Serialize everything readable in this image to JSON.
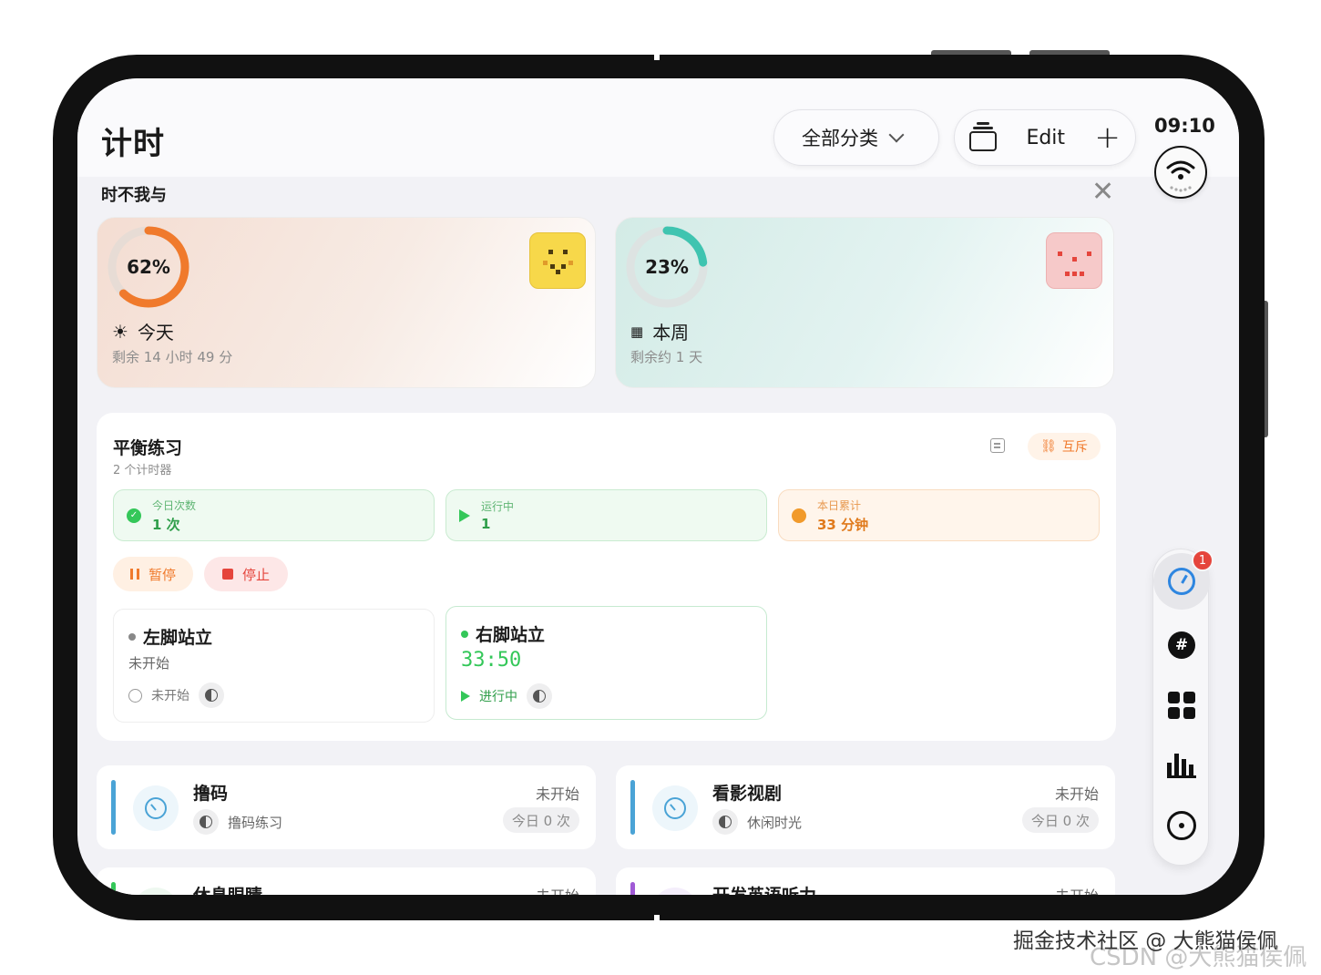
{
  "header": {
    "title": "计时",
    "category_filter": "全部分类",
    "edit_label": "Edit",
    "time": "09:10"
  },
  "section": {
    "title": "时不我与"
  },
  "progress": {
    "today": {
      "percent_label": "62%",
      "percent": 62,
      "label": "今天",
      "remaining": "剩余 14 小时 49 分",
      "color": "#f07a2c"
    },
    "week": {
      "percent_label": "23%",
      "percent": 23,
      "label": "本周",
      "remaining": "剩余约 1 天",
      "color": "#3fc4b0"
    }
  },
  "group": {
    "title": "平衡练习",
    "subtitle": "2 个计时器",
    "mutex_label": "互斥",
    "stats": [
      {
        "label": "今日次数",
        "value": "1 次"
      },
      {
        "label": "运行中",
        "value": "1"
      },
      {
        "label": "本日累计",
        "value": "33 分钟"
      }
    ],
    "pause_label": "暂停",
    "stop_label": "停止",
    "timers": [
      {
        "title": "左脚站立",
        "status": "未开始",
        "state": "未开始"
      },
      {
        "title": "右脚站立",
        "time": "33:50",
        "state": "进行中"
      }
    ]
  },
  "timers": [
    {
      "title": "撸码",
      "category": "撸码练习",
      "status": "未开始",
      "count": "今日 0 次",
      "accent": "#4aa3d6"
    },
    {
      "title": "看影视剧",
      "category": "休闲时光",
      "status": "未开始",
      "count": "今日 0 次",
      "accent": "#4aa3d6"
    },
    {
      "title": "休息眼睛",
      "status": "未开始",
      "accent": "#34c759"
    },
    {
      "title": "开发英语听力",
      "status": "未开始",
      "accent": "#a05ad6"
    }
  ],
  "dock": {
    "badge": "1",
    "hash": "#"
  },
  "watermark": {
    "line1": "掘金技术社区 @ 大熊猫侯佩",
    "line2": "CSDN @大熊猫侯佩"
  }
}
